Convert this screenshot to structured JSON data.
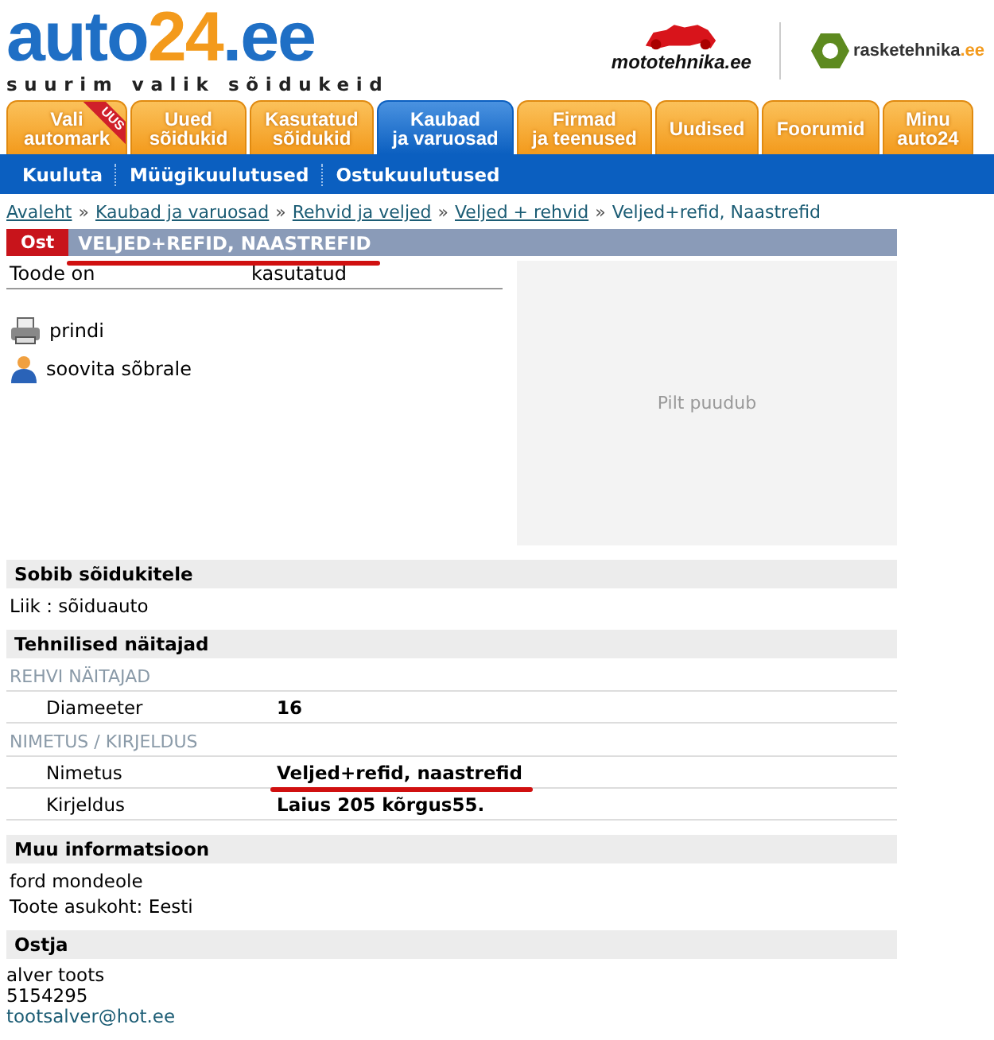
{
  "logo": {
    "parts": [
      {
        "text": "auto",
        "kind": "main"
      },
      {
        "text": "24",
        "kind": "accent"
      },
      {
        "text": ".ee",
        "kind": "main"
      }
    ],
    "tagline": "suurim valik sõidukeid"
  },
  "partners": [
    {
      "kind": "moto",
      "parts": [
        {
          "text": "mototehnika.ee",
          "kind": "main"
        }
      ]
    },
    {
      "kind": "raske",
      "parts": [
        {
          "text": "rasketehnika",
          "kind": "main"
        },
        {
          "text": ".ee",
          "kind": "accent"
        }
      ]
    }
  ],
  "tabs": [
    {
      "lines": [
        "Vali",
        "automark"
      ],
      "badge": "UUS",
      "selected": false
    },
    {
      "lines": [
        "Uued",
        "sõidukid"
      ],
      "selected": false
    },
    {
      "lines": [
        "Kasutatud",
        "sõidukid"
      ],
      "selected": false
    },
    {
      "lines": [
        "Kaubad",
        "ja varuosad"
      ],
      "selected": true
    },
    {
      "lines": [
        "Firmad",
        "ja teenused"
      ],
      "selected": false
    },
    {
      "lines": [
        "Uudised"
      ],
      "selected": false
    },
    {
      "lines": [
        "Foorumid"
      ],
      "selected": false
    },
    {
      "lines": [
        "Minu",
        "auto24"
      ],
      "selected": false
    }
  ],
  "subnav": [
    "Kuuluta",
    "Müügikuulutused",
    "Ostukuulutused"
  ],
  "breadcrumb": [
    {
      "kind": "link",
      "text": "Avaleht"
    },
    {
      "kind": "sep",
      "text": "»"
    },
    {
      "kind": "link",
      "text": "Kaubad ja varuosad"
    },
    {
      "kind": "sep",
      "text": "»"
    },
    {
      "kind": "link",
      "text": "Rehvid ja veljed"
    },
    {
      "kind": "sep",
      "text": "»"
    },
    {
      "kind": "link",
      "text": "Veljed + rehvid"
    },
    {
      "kind": "sep",
      "text": "»"
    },
    {
      "kind": "current",
      "text": "Veljed+refid, Naastrefid"
    }
  ],
  "listing": {
    "type_badge": "Ost",
    "title": "VELJED+REFID, NAASTREFID",
    "underlined": true
  },
  "condition": {
    "label": "Toode on",
    "value": "kasutatud"
  },
  "actions": [
    {
      "kind": "print",
      "label": "prindi"
    },
    {
      "kind": "person",
      "label": "soovita sõbrale"
    }
  ],
  "image_placeholder": "Pilt puudub",
  "sections": [
    {
      "title": "Sobib sõidukitele",
      "lines": [
        "Liik : sõiduauto"
      ]
    },
    {
      "title": "Tehnilised näitajad",
      "groups": [
        {
          "title": "REHVI NÄITAJAD",
          "rows": [
            {
              "label": "Diameeter",
              "value": "16",
              "underlined": false
            }
          ]
        },
        {
          "title": "NIMETUS / KIRJELDUS",
          "rows": [
            {
              "label": "Nimetus",
              "value": "Veljed+refid, naastrefid",
              "underlined": true
            },
            {
              "label": "Kirjeldus",
              "value": "Laius 205 kõrgus55.",
              "underlined": false
            }
          ]
        }
      ]
    },
    {
      "title": "Muu informatsioon",
      "lines": [
        "ford mondeole",
        "Toote asukoht: Eesti"
      ]
    },
    {
      "title": "Ostja",
      "contact": [
        "alver toots",
        "5154295"
      ],
      "email": "tootsalver@hot.ee"
    }
  ]
}
